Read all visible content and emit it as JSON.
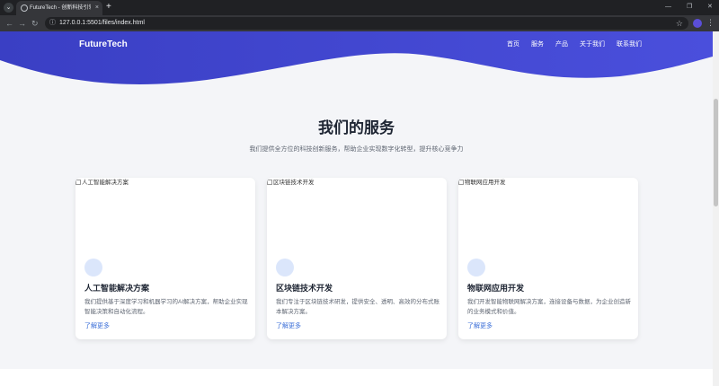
{
  "browser": {
    "tab_title": "FutureTech - 创新科技引领未来",
    "tab_close": "×",
    "new_tab": "+",
    "url": "127.0.0.1:5501/files/index.html",
    "controls": {
      "back": "←",
      "forward": "→",
      "reload": "↻",
      "site_info": "ⓘ",
      "star": "☆",
      "menu": "⋮",
      "minimize": "—",
      "restore": "❐",
      "close": "✕",
      "tab_menu": "⌄"
    }
  },
  "header": {
    "brand": "FutureTech",
    "nav": [
      "首页",
      "服务",
      "产品",
      "关于我们",
      "联系我们"
    ]
  },
  "services": {
    "title": "我们的服务",
    "subtitle": "我们提供全方位的科技创新服务，帮助企业实现数字化转型，提升核心竞争力",
    "cards": [
      {
        "image_alt": "人工智能解决方案",
        "title": "人工智能解决方案",
        "description": "我们提供基于深度学习和机器学习的AI解决方案，帮助企业实现智能决策和自动化流程。",
        "link": "了解更多"
      },
      {
        "image_alt": "区块链技术开发",
        "title": "区块链技术开发",
        "description": "我们专注于区块链技术研发，提供安全、透明、高效的分布式账本解决方案。",
        "link": "了解更多"
      },
      {
        "image_alt": "物联网应用开发",
        "title": "物联网应用开发",
        "description": "我们开发智能物联网解决方案，连接设备与数据，为企业创造新的业务模式和价值。",
        "link": "了解更多"
      }
    ]
  },
  "colors": {
    "hero": "#4a4fdc",
    "accent": "#3b6fd8",
    "card_circle": "#dbe6fb",
    "page_bg": "#f4f5f8"
  }
}
